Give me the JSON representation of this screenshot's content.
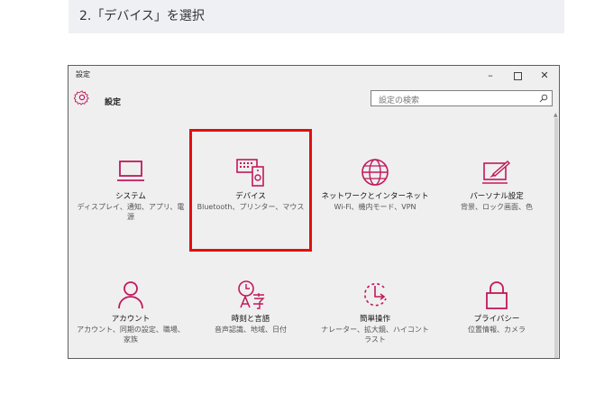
{
  "step_heading": "2.「デバイス」を選択",
  "window": {
    "title": "設定",
    "buttons": {
      "minimize": "–",
      "close": "✕"
    }
  },
  "header": {
    "title": "設定",
    "search_placeholder": "設定の検索"
  },
  "colors": {
    "accent": "#c2185b",
    "highlight": "#e20f0f"
  },
  "tiles": [
    {
      "icon": "monitor-icon",
      "title": "システム",
      "desc": "ディスプレイ、通知、アプリ、電源"
    },
    {
      "icon": "devices-icon",
      "title": "デバイス",
      "desc": "Bluetooth、プリンター、マウス"
    },
    {
      "icon": "globe-icon",
      "title": "ネットワークとインターネット",
      "desc": "Wi-Fi、機内モード、VPN"
    },
    {
      "icon": "personalization-icon",
      "title": "パーソナル設定",
      "desc": "背景、ロック画面、色"
    },
    {
      "icon": "person-icon",
      "title": "アカウント",
      "desc": "アカウント、同期の設定、職場、家族"
    },
    {
      "icon": "time-language-icon",
      "title": "時刻と言語",
      "desc": "音声認識、地域、日付"
    },
    {
      "icon": "ease-of-access-icon",
      "title": "簡単操作",
      "desc": "ナレーター、拡大鏡、ハイコントラスト"
    },
    {
      "icon": "lock-icon",
      "title": "プライバシー",
      "desc": "位置情報、カメラ"
    }
  ]
}
